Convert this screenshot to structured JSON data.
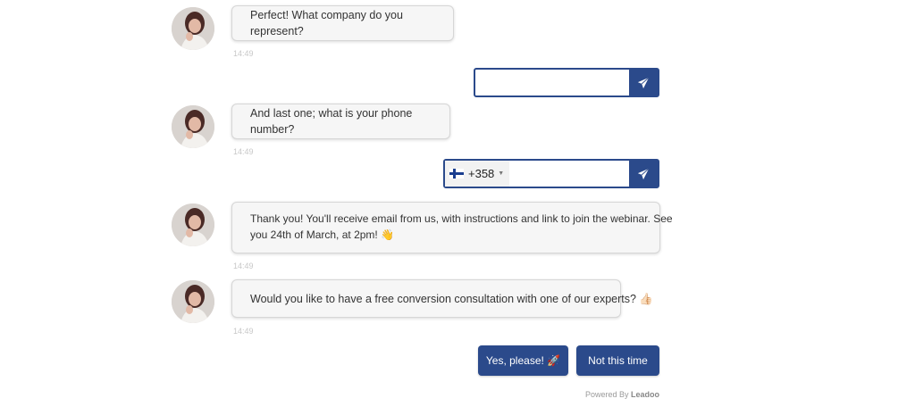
{
  "colors": {
    "accent": "#2b4a8b",
    "bubble_bg": "#f6f6f6",
    "timestamp": "#c8c8c8"
  },
  "messages": [
    {
      "text": "Perfect! What company do you represent?",
      "time": "14:49"
    },
    {
      "text": "And last one; what is your phone number?",
      "time": "14:49"
    },
    {
      "line1": "Thank you! You'll receive email from us, with instructions and link to join the webinar. See",
      "line2": "you 24th of March, at 2pm! 👋",
      "time": "14:49"
    },
    {
      "text": "Would you like to have a free conversion consultation with one of our experts? 👍🏻",
      "time": "14:49"
    }
  ],
  "company_input": {
    "value": "",
    "send_icon": "paper-plane-icon"
  },
  "phone_input": {
    "country_flag": "finland-flag-icon",
    "dial_code": "+358",
    "value": "",
    "send_icon": "paper-plane-icon"
  },
  "choices": [
    {
      "label": "Yes, please! 🚀"
    },
    {
      "label": "Not this time"
    }
  ],
  "footer": {
    "prefix": "Powered By",
    "brand": "Leadoo"
  }
}
